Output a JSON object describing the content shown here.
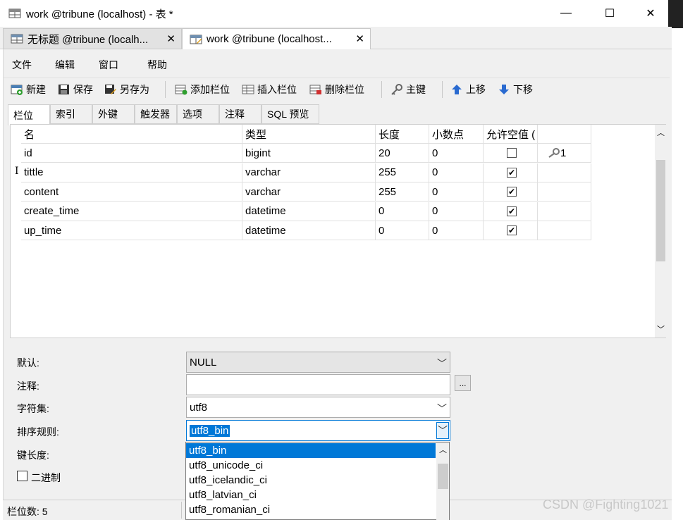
{
  "window": {
    "title": "work @tribune (localhost) - 表 *",
    "minimize": "—",
    "maximize": "☐",
    "close": "✕"
  },
  "tabs": [
    {
      "label": "无标题 @tribune (localh...",
      "close": "✕"
    },
    {
      "label": "work @tribune (localhost...",
      "close": "✕"
    }
  ],
  "menu": [
    "文件",
    "编辑",
    "窗口",
    "帮助"
  ],
  "toolbar": {
    "new": "新建",
    "save": "保存",
    "save_as": "另存为",
    "add_column": "添加栏位",
    "insert_column": "插入栏位",
    "delete_column": "删除栏位",
    "primary_key": "主键",
    "move_up": "上移",
    "move_down": "下移"
  },
  "subtabs": [
    "栏位",
    "索引",
    "外键",
    "触发器",
    "选项",
    "注释",
    "SQL 预览"
  ],
  "grid": {
    "headers": [
      "名",
      "类型",
      "长度",
      "小数点",
      "允许空值 (",
      ""
    ],
    "rows": [
      {
        "name": "id",
        "type": "bigint",
        "length": "20",
        "decimals": "0",
        "nullable": false,
        "key": "1"
      },
      {
        "name": "tittle",
        "type": "varchar",
        "length": "255",
        "decimals": "0",
        "nullable": true,
        "key": ""
      },
      {
        "name": "content",
        "type": "varchar",
        "length": "255",
        "decimals": "0",
        "nullable": true,
        "key": ""
      },
      {
        "name": "create_time",
        "type": "datetime",
        "length": "0",
        "decimals": "0",
        "nullable": true,
        "key": ""
      },
      {
        "name": "up_time",
        "type": "datetime",
        "length": "0",
        "decimals": "0",
        "nullable": true,
        "key": ""
      }
    ]
  },
  "properties": {
    "default_label": "默认:",
    "default_value": "NULL",
    "comment_label": "注释:",
    "comment_value": "",
    "comment_btn": "...",
    "charset_label": "字符集:",
    "charset_value": "utf8",
    "collation_label": "排序规则:",
    "collation_value": "utf8_bin",
    "key_length_label": "键长度:",
    "binary_label": "二进制"
  },
  "collation_options": [
    "utf8_bin",
    "utf8_unicode_ci",
    "utf8_icelandic_ci",
    "utf8_latvian_ci",
    "utf8_romanian_ci"
  ],
  "status": {
    "count": "栏位数: 5"
  },
  "watermark": "CSDN @Fighting1021",
  "colors": {
    "selection": "#0078d7",
    "panel": "#f0f0f0"
  }
}
